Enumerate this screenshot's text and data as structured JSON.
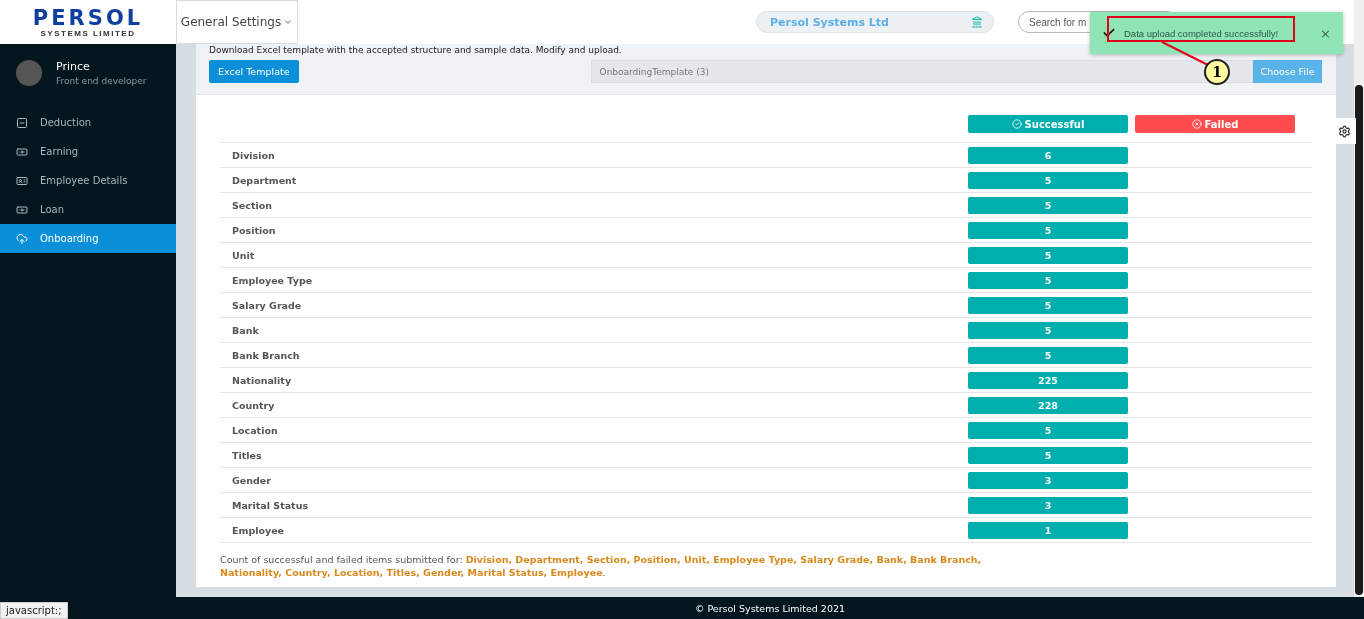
{
  "logo": {
    "name": "PERSOL",
    "tagline": "SYSTEMS LIMITED"
  },
  "header": {
    "menu": "General Settings",
    "company": "Persol Systems Ltd",
    "search": {
      "placeholder": "Search for m"
    }
  },
  "toast": {
    "message": "Data upload completed successfully!",
    "close": "×"
  },
  "annotation": {
    "number": "1"
  },
  "sidebar": {
    "user": {
      "name": "Prince",
      "role": "Front end developer"
    },
    "items": [
      {
        "label": "Deduction",
        "kind": "deduction",
        "selected": false
      },
      {
        "label": "Earning",
        "kind": "earning",
        "selected": false
      },
      {
        "label": "Employee Details",
        "kind": "employee",
        "selected": false
      },
      {
        "label": "Loan",
        "kind": "loan",
        "selected": false
      },
      {
        "label": "Onboarding",
        "kind": "onboarding",
        "selected": true
      }
    ]
  },
  "upload": {
    "hint": "Download Excel template with the accepted structure and sample data. Modify and upload.",
    "template_button": "Excel Template",
    "file_name": "OnboardingTemplate (3)",
    "choose_button": "Choose File"
  },
  "results": {
    "columns": [
      "Successful",
      "Failed"
    ],
    "rows": [
      {
        "label": "Division",
        "successful": "6"
      },
      {
        "label": "Department",
        "successful": "5"
      },
      {
        "label": "Section",
        "successful": "5"
      },
      {
        "label": "Position",
        "successful": "5"
      },
      {
        "label": "Unit",
        "successful": "5"
      },
      {
        "label": "Employee Type",
        "successful": "5"
      },
      {
        "label": "Salary Grade",
        "successful": "5"
      },
      {
        "label": "Bank",
        "successful": "5"
      },
      {
        "label": "Bank Branch",
        "successful": "5"
      },
      {
        "label": "Nationality",
        "successful": "225"
      },
      {
        "label": "Country",
        "successful": "228"
      },
      {
        "label": "Location",
        "successful": "5"
      },
      {
        "label": "Titles",
        "successful": "5"
      },
      {
        "label": "Gender",
        "successful": "3"
      },
      {
        "label": "Marital Status",
        "successful": "3"
      },
      {
        "label": "Employee",
        "successful": "1"
      }
    ],
    "note": "Count of successful and failed items submitted for: **Division, Department, Section, Position, Unit, Employee Type, Salary Grade, Bank, Bank Branch, Nationality, Country, Location, Titles, Gender, Marital Status, Employee**."
  },
  "footer": "© Persol Systems Limited 2021",
  "status_url": "javascript:;"
}
